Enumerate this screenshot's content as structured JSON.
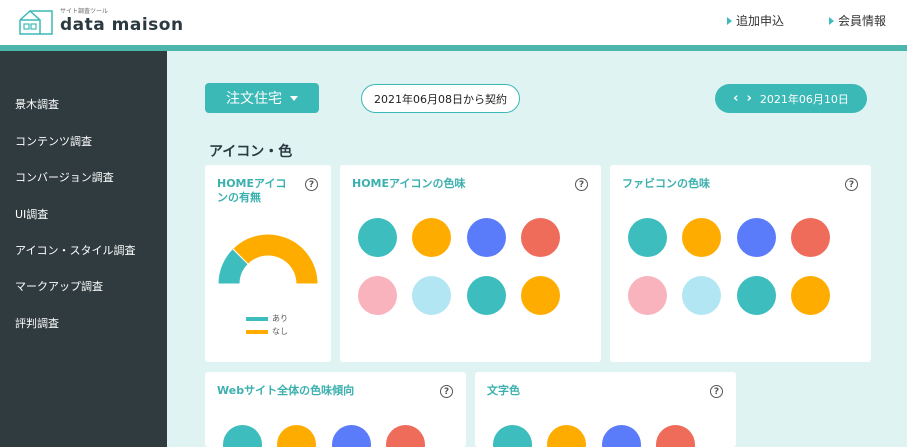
{
  "header": {
    "logo_sub": "サイト調査ツール",
    "logo_text": "data maison",
    "links": [
      "追加申込",
      "会員情報"
    ]
  },
  "sidebar": {
    "items": [
      "景木調査",
      "コンテンツ調査",
      "コンバージョン調査",
      "UI調査",
      "アイコン・スタイル調査",
      "マークアップ調査",
      "評判調査"
    ]
  },
  "toolbar": {
    "dropdown_label": "注文住宅",
    "contract_text": "2021年06月08日から契約",
    "current_date": "2021年06月10日"
  },
  "section": {
    "title": "アイコン・色"
  },
  "cards": {
    "home_icon_presence": {
      "title_line1": "HOMEアイコ",
      "title_line2": "ンの有無",
      "legend": [
        "あり",
        "なし"
      ]
    },
    "home_icon_color": {
      "title": "HOMEアイコンの色味"
    },
    "favicon_color": {
      "title": "ファビコンの色味"
    },
    "site_color": {
      "title": "Webサイト全体の色味傾向"
    },
    "text_color": {
      "title": "文字色"
    }
  },
  "colors": {
    "teal": "#3dbdbd",
    "amber": "#ffac00",
    "blue": "#5b7cfa",
    "coral": "#ef6b5a",
    "pink": "#f8b3bc",
    "light_blue": "#b2e6f3"
  },
  "chart_data": {
    "type": "pie",
    "categories": [
      "あり",
      "なし"
    ],
    "values": [
      25,
      75
    ]
  }
}
